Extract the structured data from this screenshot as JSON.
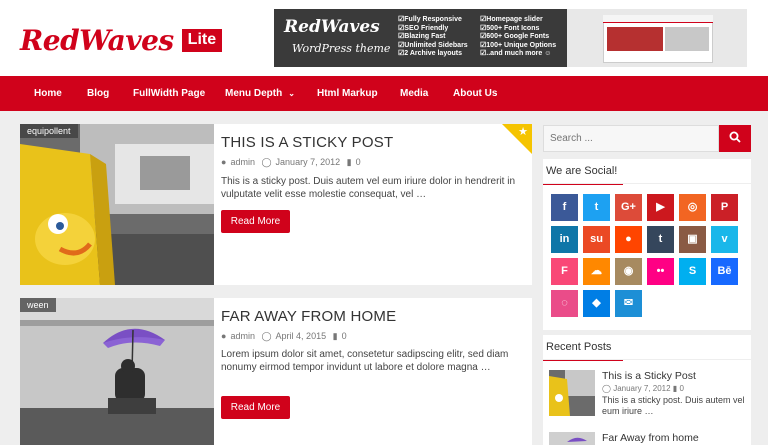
{
  "site": {
    "logo_text": "RedWaves",
    "logo_badge": "Lite"
  },
  "banner": {
    "title": "RedWaves",
    "subtitle": "WordPress theme",
    "features_left": [
      "Fully Responsive",
      "SEO Friendly",
      "Blazing Fast",
      "Unlimited Sidebars",
      "2 Archive layouts"
    ],
    "features_right": [
      "Homepage slider",
      "500+ Font Icons",
      "600+ Google Fonts",
      "100+ Unique Options",
      "..and much more ☺"
    ]
  },
  "nav": {
    "items": [
      "Home",
      "Blog",
      "FullWidth Page",
      "Menu Depth",
      "Html Markup",
      "Media",
      "About Us"
    ]
  },
  "posts": [
    {
      "tag": "equipollent",
      "title": "THIS IS A STICKY POST",
      "author": "admin",
      "date": "January 7, 2012",
      "comments": "0",
      "excerpt": "This is a sticky post. Duis autem vel eum iriure dolor in hendrerit in vulputate velit esse molestie consequat, vel …",
      "read_more": "Read More"
    },
    {
      "tag": "ween",
      "title": "FAR AWAY FROM HOME",
      "author": "admin",
      "date": "April 4, 2015",
      "comments": "0",
      "excerpt": "Lorem ipsum dolor sit amet, consetetur sadipscing elitr, sed diam nonumy eirmod tempor invidunt ut labore et dolore magna …",
      "read_more": "Read More"
    }
  ],
  "sidebar": {
    "search_placeholder": "Search ...",
    "social_title": "We are Social!",
    "social_icons": [
      {
        "name": "facebook",
        "glyph": "f",
        "color": "#3b5998"
      },
      {
        "name": "twitter",
        "glyph": "t",
        "color": "#1da1f2"
      },
      {
        "name": "google-plus",
        "glyph": "G+",
        "color": "#dd4b39"
      },
      {
        "name": "youtube",
        "glyph": "▶",
        "color": "#cc181e"
      },
      {
        "name": "rss",
        "glyph": "◎",
        "color": "#f26522"
      },
      {
        "name": "pinterest",
        "glyph": "P",
        "color": "#cb2027"
      },
      {
        "name": "linkedin",
        "glyph": "in",
        "color": "#0e76a8"
      },
      {
        "name": "stumbleupon",
        "glyph": "su",
        "color": "#eb4924"
      },
      {
        "name": "reddit",
        "glyph": "●",
        "color": "#ff4500"
      },
      {
        "name": "tumblr",
        "glyph": "t",
        "color": "#35465c"
      },
      {
        "name": "instagram",
        "glyph": "▣",
        "color": "#8a5a44"
      },
      {
        "name": "vimeo",
        "glyph": "v",
        "color": "#1ab7ea"
      },
      {
        "name": "foursquare",
        "glyph": "F",
        "color": "#f94877"
      },
      {
        "name": "soundcloud",
        "glyph": "☁",
        "color": "#ff8800"
      },
      {
        "name": "github",
        "glyph": "◉",
        "color": "#a78a60"
      },
      {
        "name": "flickr",
        "glyph": "••",
        "color": "#ff0084"
      },
      {
        "name": "skype",
        "glyph": "S",
        "color": "#00aff0"
      },
      {
        "name": "behance",
        "glyph": "Bē",
        "color": "#1769ff"
      },
      {
        "name": "dribbble",
        "glyph": "◌",
        "color": "#ea4c89"
      },
      {
        "name": "dropbox",
        "glyph": "◆",
        "color": "#007ee5"
      },
      {
        "name": "email",
        "glyph": "✉",
        "color": "#1d8fd6"
      }
    ],
    "recent_title": "Recent Posts",
    "recent_posts": [
      {
        "title": "This is a Sticky Post",
        "date": "January 7, 2012",
        "comments": "0",
        "excerpt": "This is a sticky post. Duis autem vel eum iriure …"
      },
      {
        "title": "Far Away from home"
      }
    ]
  },
  "colors": {
    "accent": "#d0021b",
    "background": "#eeeeee"
  }
}
